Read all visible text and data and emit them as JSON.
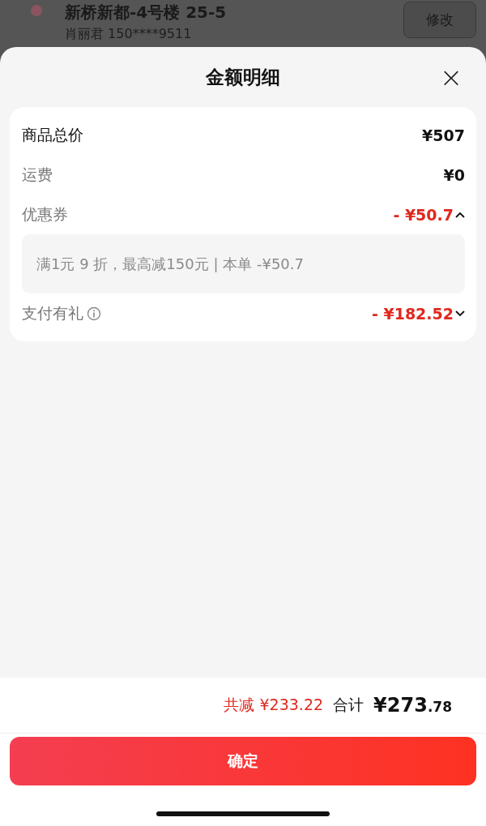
{
  "background": {
    "address": "新桥新都-4号楼 25-5",
    "contact": "肖丽君  150****9511",
    "edit_button": "修改"
  },
  "sheet": {
    "title": "金额明细",
    "close": "×"
  },
  "rows": [
    {
      "kind": "total",
      "label": "商品总价",
      "value": "¥507"
    },
    {
      "kind": "fee",
      "label": "运费",
      "value": "¥0"
    },
    {
      "kind": "discount",
      "label": "优惠券",
      "value": "- ¥50.7",
      "expanded": true,
      "info": false,
      "detail": "满1元 9 折，最高减150元 | 本单 -¥50.7"
    },
    {
      "kind": "discount",
      "label": "支付有礼",
      "value": "- ¥182.52",
      "expanded": false,
      "info": true
    }
  ],
  "footer": {
    "savings": "共减 ¥233.22",
    "total_label": "合计",
    "amount_main": "¥273",
    "amount_fraction": ".78",
    "confirm": "确定"
  }
}
